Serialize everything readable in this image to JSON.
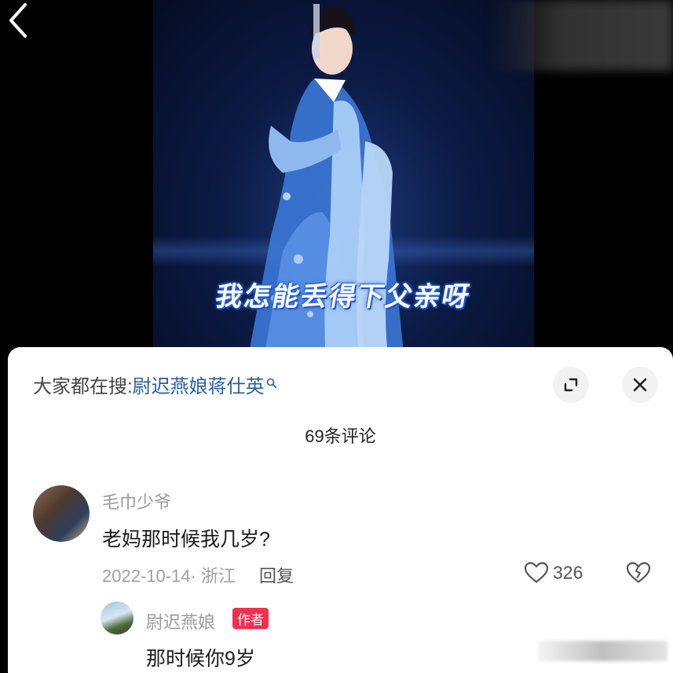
{
  "video": {
    "subtitle": "我怎能丢得下父亲呀"
  },
  "sheet": {
    "search_prefix": "大家都在搜:",
    "search_term": "尉迟燕娘蒋仕英",
    "comment_count": "69条评论"
  },
  "comment": {
    "username": "毛巾少爷",
    "text": "老妈那时候我几岁?",
    "date_location": "2022-10-14· 浙江",
    "reply_label": "回复",
    "like_count": "326"
  },
  "reply": {
    "username": "尉迟燕娘",
    "badge": "作者",
    "text": "那时候你9岁"
  },
  "colors": {
    "accent_link": "#2a5f9e",
    "badge_red": "#f0304f",
    "stage_blue": "#1b3a7a"
  },
  "icons": {
    "back": "chevron-left",
    "search": "magnifier",
    "expand": "expand-corners",
    "close": "x-mark",
    "like": "heart-outline",
    "dislike": "broken-heart-outline"
  }
}
